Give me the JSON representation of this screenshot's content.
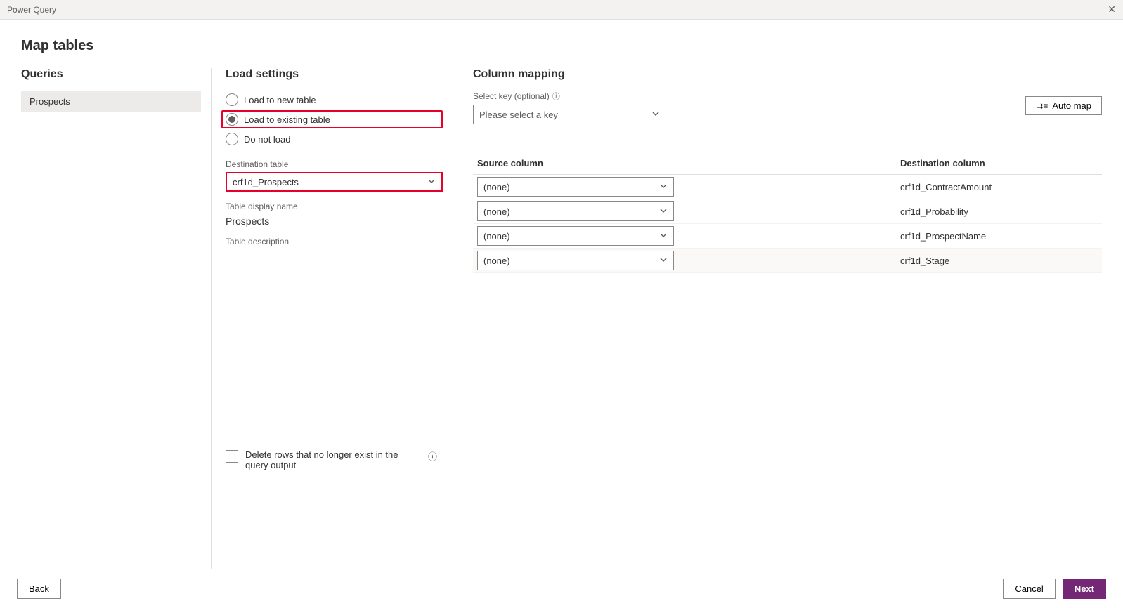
{
  "window": {
    "title": "Power Query"
  },
  "page": {
    "title": "Map tables"
  },
  "queries": {
    "heading": "Queries",
    "items": [
      "Prospects"
    ]
  },
  "load": {
    "heading": "Load settings",
    "radios": {
      "new": "Load to new table",
      "existing": "Load to existing table",
      "none": "Do not load"
    },
    "selected_radio": "existing",
    "destination_label": "Destination table",
    "destination_value": "crf1d_Prospects",
    "display_name_label": "Table display name",
    "display_name_value": "Prospects",
    "description_label": "Table description",
    "description_value": "",
    "delete_rows_label": "Delete rows that no longer exist in the query output"
  },
  "mapping": {
    "heading": "Column mapping",
    "key_label": "Select key (optional)",
    "key_placeholder": "Please select a key",
    "auto_map_label": "Auto map",
    "th_source": "Source column",
    "th_dest": "Destination column",
    "none_label": "(none)",
    "rows": [
      {
        "source": "(none)",
        "dest": "crf1d_ContractAmount"
      },
      {
        "source": "(none)",
        "dest": "crf1d_Probability"
      },
      {
        "source": "(none)",
        "dest": "crf1d_ProspectName"
      },
      {
        "source": "(none)",
        "dest": "crf1d_Stage"
      }
    ]
  },
  "footer": {
    "back": "Back",
    "cancel": "Cancel",
    "next": "Next"
  }
}
